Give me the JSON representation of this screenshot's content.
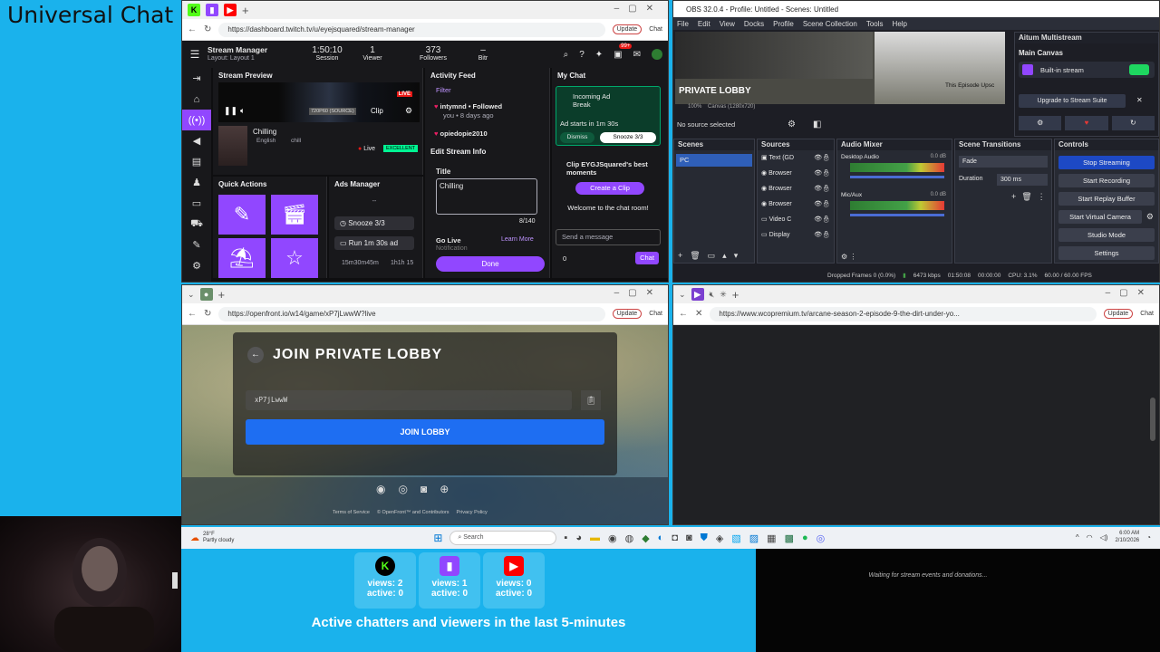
{
  "overlay": {
    "title": "Universal Chat",
    "stats": [
      {
        "platform": "kick",
        "icon": "kick-icon",
        "color": "#000000",
        "views": "views: 2",
        "active": "active: 0"
      },
      {
        "platform": "twitch",
        "icon": "twitch-icon",
        "color": "#9146ff",
        "views": "views: 1",
        "active": "active: 0"
      },
      {
        "platform": "youtube",
        "icon": "youtube-icon",
        "color": "#ff0000",
        "views": "views: 0",
        "active": "active: 0"
      }
    ],
    "caption": "Active chatters and viewers in the last 5-minutes",
    "donations_text": "Waiting for stream events and donations..."
  },
  "twitch_window": {
    "url": "https://dashboard.twitch.tv/u/eyejsquared/stream-manager",
    "update_label": "Update",
    "chat_label": "Chat",
    "header": {
      "title": "Stream Manager",
      "layout": "Layout: Layout 1",
      "session_value": "1:50:10",
      "session_label": "Session",
      "viewer_value": "1",
      "viewer_label": "Viewer",
      "followers_value": "373",
      "followers_label": "Followers",
      "bitrate_value": "–",
      "bitrate_label": "Bitr",
      "notif_badge": "99+"
    },
    "preview": {
      "title": "Stream Preview",
      "quality": "720P60 (SOURCE)",
      "clip": "Clip",
      "live_badge": "LIVE",
      "stream_title": "Chilling",
      "tag1": "English",
      "tag2": "chill",
      "live_text": "Live",
      "health": "EXCELLENT"
    },
    "quick_actions": {
      "title": "Quick Actions"
    },
    "ads_manager": {
      "title": "Ads Manager",
      "dash": "--",
      "snooze": "Snooze 3/3",
      "run": "Run 1m 30s ad",
      "countdown1": "15m30m45m",
      "countdown2": "1h1h 15"
    },
    "activity": {
      "title": "Activity Feed",
      "filter": "Filter",
      "item1_name": "intymnd",
      "item1_action": "• Followed",
      "item1_sub": "you • 8 days ago",
      "item2_name": "opiedopie2010"
    },
    "edit_info": {
      "title": "Edit Stream Info",
      "title_label": "Title",
      "title_value": "Chilling",
      "count": "8/140",
      "golive": "Go Live",
      "notif": "Notification",
      "learn": "Learn",
      "more": "More",
      "done": "Done"
    },
    "chat": {
      "title": "My Chat",
      "incoming": "Incoming Ad Break",
      "ad_starts": "Ad starts in 1m 30s",
      "dismiss": "Dismiss",
      "snooze": "Snooze 3/3",
      "clip_title": "Clip EYGJSquared's best moments",
      "create_clip": "Create a Clip",
      "welcome": "Welcome to the chat room!",
      "placeholder": "Send a message",
      "points": "0",
      "chat_btn": "Chat"
    }
  },
  "obs_window": {
    "title": "OBS 32.0.4 - Profile: Untitled - Scenes: Untitled",
    "menu": [
      "File",
      "Edit",
      "View",
      "Docks",
      "Profile",
      "Scene Collection",
      "Tools",
      "Help"
    ],
    "preview_text": "PRIVATE LOBBY",
    "episode_text": "This Episode Upsc",
    "zoom": "100%",
    "canvas": "Canvas (1280x720)",
    "no_source": "No source selected",
    "multistream": {
      "title": "Aitum Multistream",
      "main_canvas": "Main Canvas",
      "builtin": "Built-in stream",
      "upgrade": "Upgrade to Stream Suite"
    },
    "scenes": {
      "title": "Scenes",
      "items": [
        "PC"
      ]
    },
    "sources": {
      "title": "Sources",
      "items": [
        "Text (GD",
        "Browser",
        "Browser",
        "Browser",
        "Video C",
        "Display"
      ]
    },
    "audio": {
      "title": "Audio Mixer",
      "ch1": "Desktop Audio",
      "ch1_db": "0.0 dB",
      "ch2": "Mic/Aux",
      "ch2_db": "0.0 dB"
    },
    "transitions": {
      "title": "Scene Transitions",
      "type": "Fade",
      "duration_label": "Duration",
      "duration": "300 ms"
    },
    "controls": {
      "title": "Controls",
      "buttons": [
        "Stop Streaming",
        "Start Recording",
        "Start Replay Buffer",
        "Start Virtual Camera",
        "Studio Mode",
        "Settings"
      ]
    },
    "status": {
      "dropped": "Dropped Frames 0 (0.0%)",
      "kbps": "6473 kbps",
      "stream_time": "01:50:08",
      "rec_time": "00:00:00",
      "cpu": "CPU: 3.1%",
      "fps": "60.00 / 60.00 FPS"
    }
  },
  "game_window": {
    "url": "https://openfront.io/w14/game/xP7jLwwW?live",
    "update_label": "Update",
    "chat_label": "Chat",
    "heading": "JOIN PRIVATE LOBBY",
    "lobby_code": "xP7jLwwW",
    "join_button": "JOIN LOBBY",
    "terms": "Terms of Service",
    "copyright": "© OpenFront™ and Contributors",
    "privacy": "Privacy Policy"
  },
  "video_window": {
    "url": "https://www.wcopremium.tv/arcane-season-2-episode-9-the-dirt-under-yo...",
    "update_label": "Update",
    "chat_label": "Chat"
  },
  "taskbar": {
    "temp": "28°F",
    "weather": "Partly cloudy",
    "search": "Search",
    "time": "6:00 AM",
    "date": "2/10/2026"
  }
}
